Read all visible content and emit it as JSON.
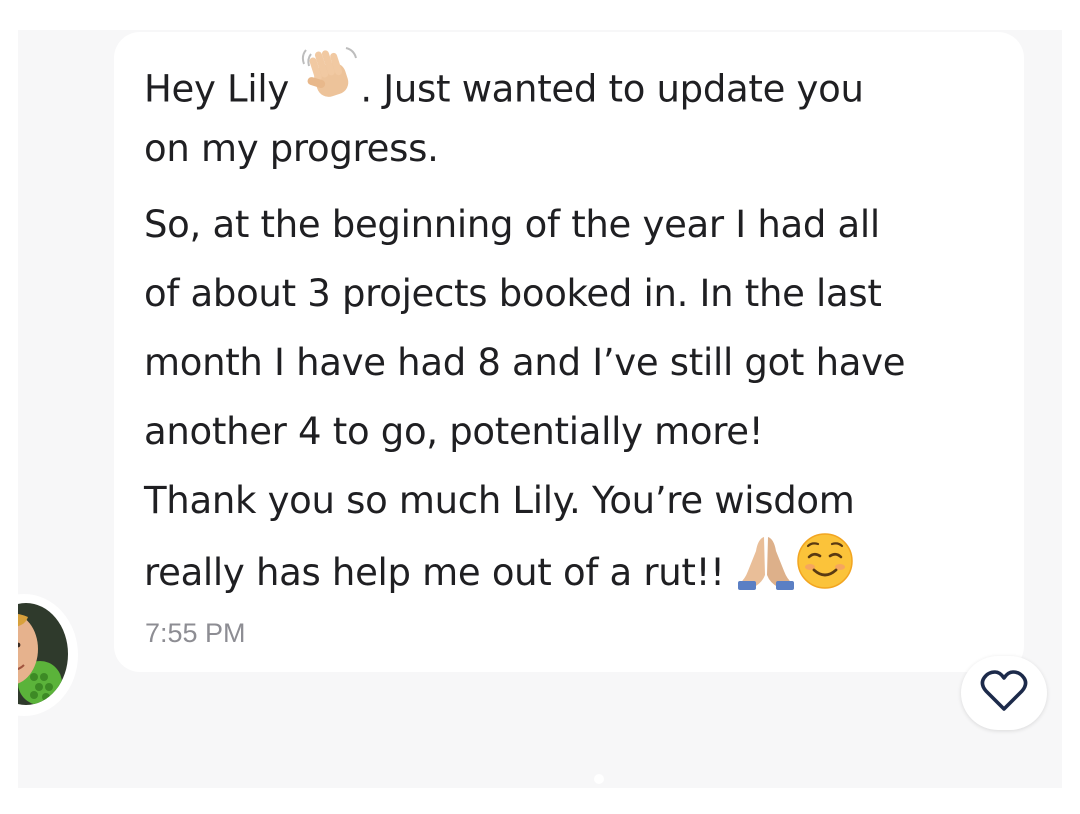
{
  "message": {
    "lines": [
      {
        "before": "Hey Lily ",
        "after": ". Just wanted to update you"
      },
      "on my progress.",
      "So, at the beginning of the year I had all",
      "of about 3 projects booked in. In the last",
      "month I have had 8 and I’ve still got have",
      "another 4 to go, potentially more!",
      "Thank you so much Lily. You’re wisdom",
      "really has help me out of a rut!! "
    ],
    "timestamp": "7:55 PM"
  },
  "icons": {
    "wave": "waving-hand-emoji",
    "pray": "folded-hands-emoji",
    "smile": "smiling-face-emoji",
    "like": "heart-outline-icon"
  },
  "colors": {
    "text": "#1f1f22",
    "timestamp": "#8d8d93",
    "panel": "#f7f7f8",
    "heart": "#1c2a4a"
  }
}
